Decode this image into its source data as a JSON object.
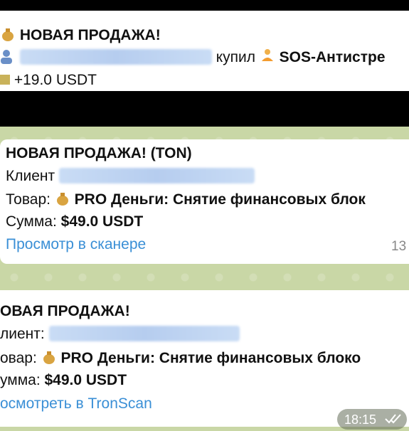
{
  "top_message": {
    "title": "НОВАЯ ПРОДАЖА!",
    "bought_text": "купил",
    "product": "SOS-Антистре",
    "amount": "+19.0 USDT"
  },
  "message_ton": {
    "title": "НОВАЯ ПРОДАЖА! (TON)",
    "client_label": "Клиент",
    "product_label": "Товар:",
    "product": "PRO Деньги: Снятие финансовых блок",
    "sum_label": "Сумма:",
    "sum": "$49.0 USDT",
    "link": "Просмотр в сканере",
    "time_partial": "13"
  },
  "message_tron": {
    "title": "ОВАЯ ПРОДАЖА!",
    "client_label": "лиент:",
    "product_label": "овар:",
    "product": "PRO Деньги: Снятие финансовых блоко",
    "sum_label": "умма:",
    "sum": "$49.0 USDT",
    "link": "осмотреть в TronScan",
    "time": "18:15"
  }
}
